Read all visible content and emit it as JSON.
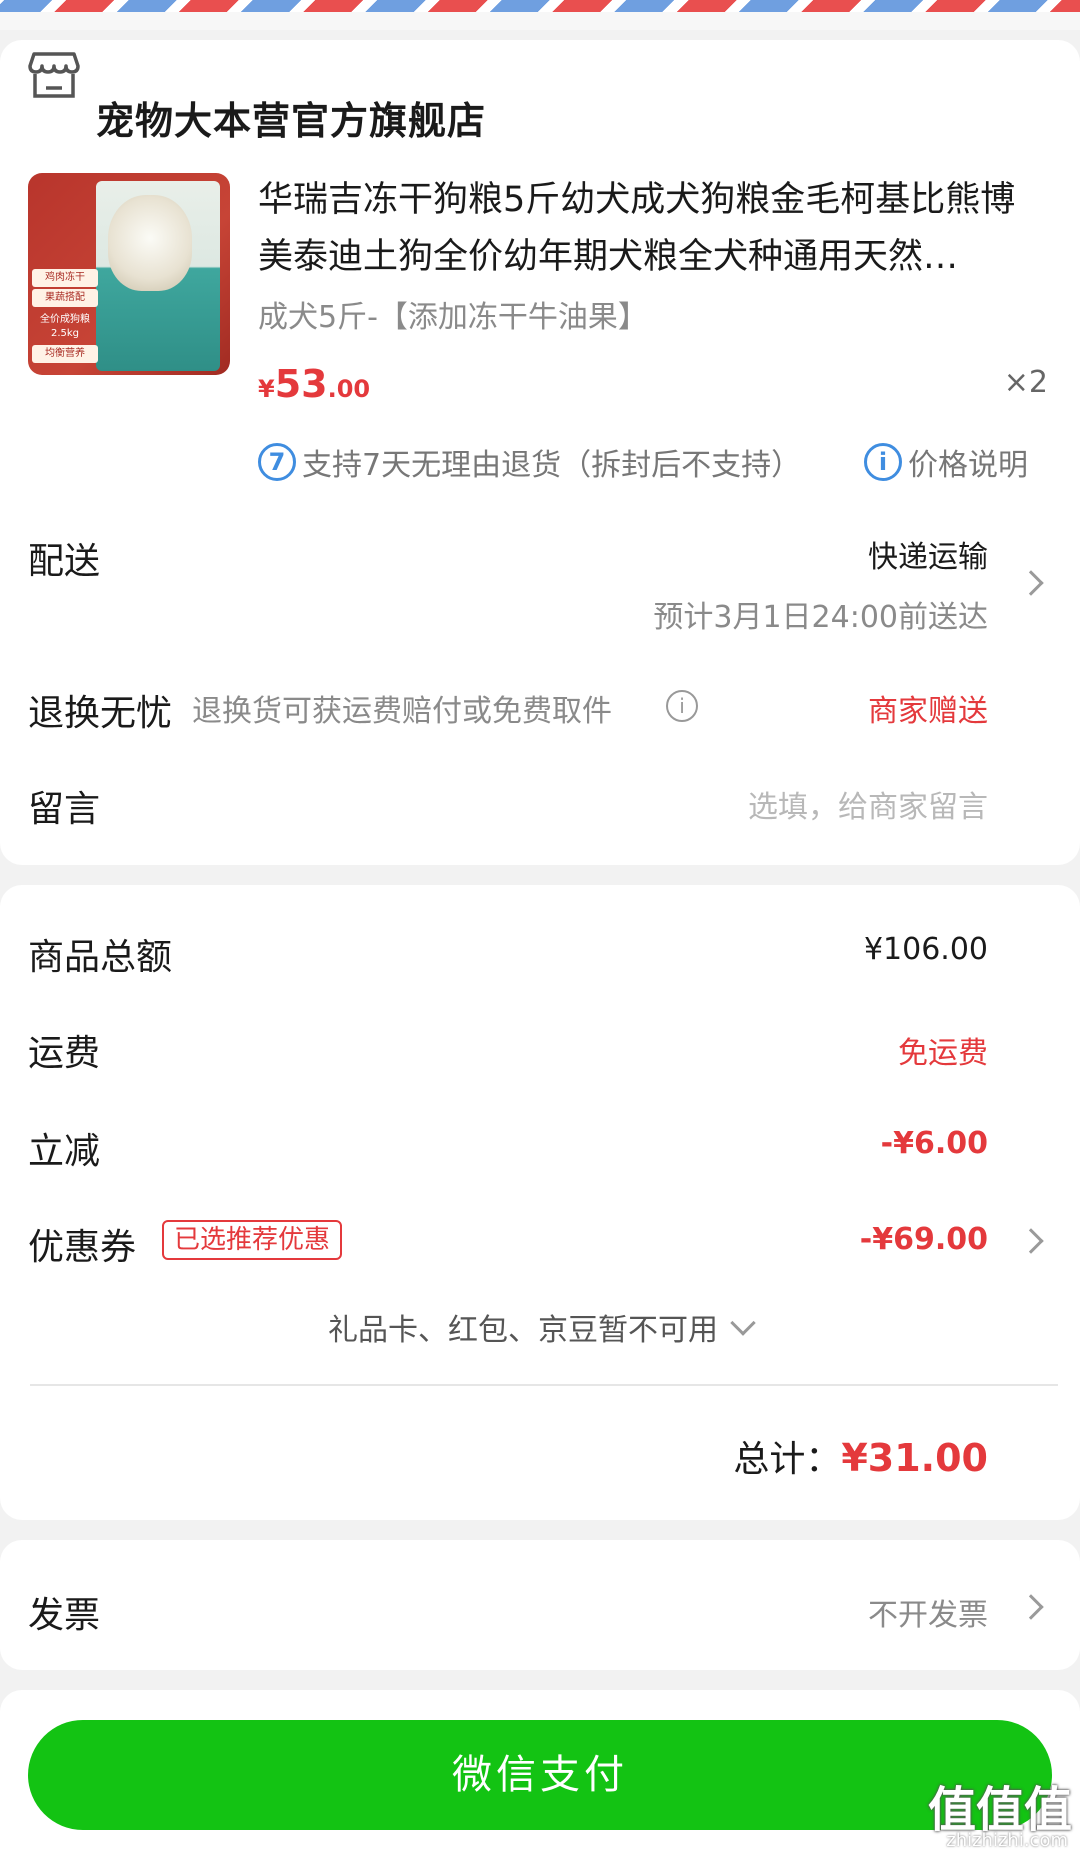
{
  "store": {
    "name": "宠物大本营官方旗舰店",
    "icon": "store-icon"
  },
  "product": {
    "title": "华瑞吉冻干狗粮5斤幼犬成犬狗粮金毛柯基比熊博美泰迪土狗全价幼年期犬粮全犬种通用天然…",
    "spec": "成犬5斤-【添加冻干牛油果】",
    "price_currency": "¥",
    "price_int": "53",
    "price_dec": ".00",
    "qty": "×2",
    "image_tags": [
      "鸡肉冻干",
      "果蔬搭配",
      "全价成狗粮",
      "2.5kg",
      "均衡营养"
    ],
    "return_badge_num": "7",
    "return_policy": "支持7天无理由退货（拆封后不支持）",
    "price_note_icon": "i",
    "price_note": "价格说明"
  },
  "delivery": {
    "label": "配送",
    "method": "快递运输",
    "eta": "预计3月1日24:00前送达"
  },
  "returns": {
    "label": "退换无忧",
    "desc": "退换货可获运费赔付或免费取件",
    "value": "商家赠送"
  },
  "message": {
    "label": "留言",
    "placeholder": "选填，给商家留言"
  },
  "summary": {
    "goods_total_label": "商品总额",
    "goods_total": "¥106.00",
    "shipping_label": "运费",
    "shipping": "免运费",
    "discount_label": "立减",
    "discount": "-¥6.00",
    "coupon_label": "优惠券",
    "coupon_badge": "已选推荐优惠",
    "coupon": "-¥69.00",
    "gift_note": "礼品卡、红包、京豆暂不可用",
    "total_label": "总计：",
    "total": "¥31.00"
  },
  "invoice": {
    "label": "发票",
    "value": "不开发票"
  },
  "pay_button": "微信支付",
  "watermark": {
    "main": "值值值",
    "sub": "zhizhizhi.com"
  },
  "colors": {
    "accent_red": "#e4393c",
    "pay_green": "#13c313",
    "info_blue": "#3f8de0"
  }
}
